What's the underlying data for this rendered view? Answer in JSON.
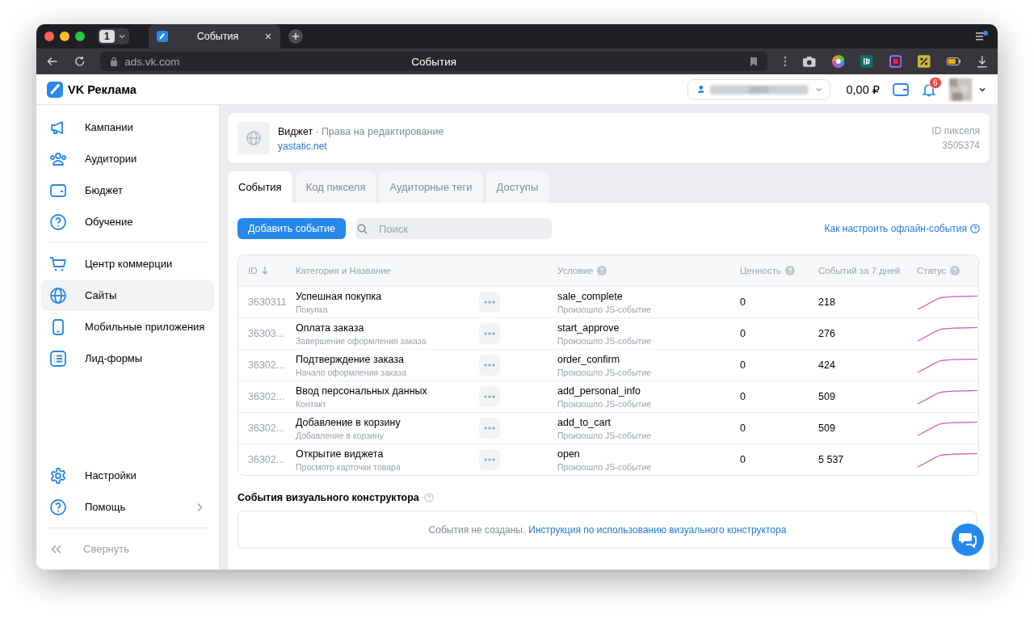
{
  "browser": {
    "tab_count": "1",
    "tab": {
      "title": "События"
    },
    "url": "ads.vk.com",
    "page_title": "События"
  },
  "header": {
    "logo": "VK Реклама",
    "balance": "0,00 ₽",
    "notifications": "6"
  },
  "sidebar": {
    "groups": [
      [
        {
          "label": "Кампании",
          "selected": false
        },
        {
          "label": "Аудитории",
          "selected": false
        },
        {
          "label": "Бюджет",
          "selected": false
        },
        {
          "label": "Обучение",
          "selected": false
        }
      ],
      [
        {
          "label": "Центр коммерции",
          "selected": false
        },
        {
          "label": "Сайты",
          "selected": true
        },
        {
          "label": "Мобильные приложения",
          "selected": false
        },
        {
          "label": "Лид-формы",
          "selected": false
        }
      ]
    ],
    "bottom_items": [
      {
        "label": "Настройки",
        "has_submenu": false
      },
      {
        "label": "Помощь",
        "has_submenu": true
      }
    ],
    "collapse": "Свернуть"
  },
  "pixel": {
    "name": "Виджет",
    "rights": "· Права на редактирование",
    "domain": "yastatic.net",
    "id_label": "ID пикселя",
    "id": "3505374"
  },
  "tabs": [
    {
      "label": "События",
      "selected": true
    },
    {
      "label": "Код пикселя",
      "selected": false
    },
    {
      "label": "Аудиторные теги",
      "selected": false
    },
    {
      "label": "Доступы",
      "selected": false
    }
  ],
  "toolbar": {
    "add_button": "Добавить событие",
    "search_placeholder": "Поиск",
    "help_link": "Как настроить офлайн-события"
  },
  "table": {
    "columns": [
      {
        "label": "ID",
        "sorted": true,
        "help": false
      },
      {
        "label": "Категория и Название",
        "sorted": false,
        "help": false
      },
      {
        "label": "Условие",
        "sorted": false,
        "help": true
      },
      {
        "label": "Ценность",
        "sorted": false,
        "help": true
      },
      {
        "label": "Событий за 7 дней",
        "sorted": false,
        "help": false
      },
      {
        "label": "Статус",
        "sorted": false,
        "help": true
      }
    ],
    "rows": [
      {
        "id": "3630311",
        "name": "Успешная покупка",
        "category": "Покупка",
        "condition": "sale_complete",
        "condition_type": "Произошло JS-событие",
        "value": "0",
        "count": "218"
      },
      {
        "id": "36303...",
        "name": "Оплата заказа",
        "category": "Завершение оформления заказа",
        "condition": "start_approve",
        "condition_type": "Произошло JS-событие",
        "value": "0",
        "count": "276"
      },
      {
        "id": "36302...",
        "name": "Подтверждение заказа",
        "category": "Начало оформления заказа",
        "condition": "order_confirm",
        "condition_type": "Произошло JS-событие",
        "value": "0",
        "count": "424"
      },
      {
        "id": "36302...",
        "name": "Ввод персональных данных",
        "category": "Контакт",
        "condition": "add_personal_info",
        "condition_type": "Произошло JS-событие",
        "value": "0",
        "count": "509"
      },
      {
        "id": "36302...",
        "name": "Добавление в корзину",
        "category": "Добавление в корзину",
        "condition": "add_to_cart",
        "condition_type": "Произошло JS-событие",
        "value": "0",
        "count": "509"
      },
      {
        "id": "36302...",
        "name": "Открытие виджета",
        "category": "Просмотр карточки товара",
        "condition": "open",
        "condition_type": "Произошло JS-событие",
        "value": "0",
        "count": "5 537"
      }
    ]
  },
  "visual_constructor": {
    "title": "События визуального конструктора",
    "empty_text": "События не созданы.",
    "link": "Инструкция по использованию визуального конструктора"
  }
}
